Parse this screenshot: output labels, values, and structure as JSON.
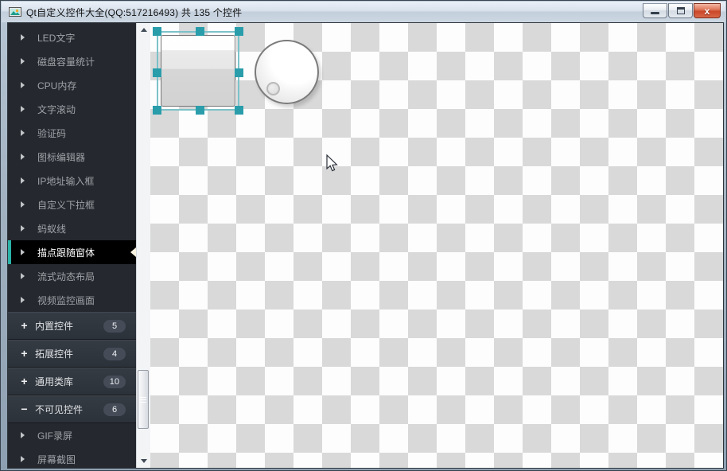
{
  "window": {
    "title": "Qt自定义控件大全(QQ:517216493) 共 135 个控件",
    "controls": {
      "minimize": "minimize-icon",
      "maximize": "maximize-icon",
      "close": "close-icon",
      "close_glyph": "x"
    }
  },
  "sidebar": {
    "items": [
      {
        "type": "item",
        "label": "LED文字"
      },
      {
        "type": "item",
        "label": "磁盘容量统计"
      },
      {
        "type": "item",
        "label": "CPU内存"
      },
      {
        "type": "item",
        "label": "文字滚动"
      },
      {
        "type": "item",
        "label": "验证码"
      },
      {
        "type": "item",
        "label": "图标编辑器"
      },
      {
        "type": "item",
        "label": "IP地址输入框"
      },
      {
        "type": "item",
        "label": "自定义下拉框"
      },
      {
        "type": "item",
        "label": "蚂蚁线"
      },
      {
        "type": "item",
        "label": "描点跟随窗体",
        "selected": true
      },
      {
        "type": "item",
        "label": "流式动态布局"
      },
      {
        "type": "item",
        "label": "视频监控画面"
      },
      {
        "type": "group",
        "label": "内置控件",
        "badge": "5",
        "state": "collapsed"
      },
      {
        "type": "group",
        "label": "拓展控件",
        "badge": "4",
        "state": "collapsed"
      },
      {
        "type": "group",
        "label": "通用类库",
        "badge": "10",
        "state": "collapsed"
      },
      {
        "type": "group",
        "label": "不可见控件",
        "badge": "6",
        "state": "expanded"
      },
      {
        "type": "item",
        "label": "GIF录屏"
      },
      {
        "type": "item",
        "label": "屏幕截图"
      }
    ]
  },
  "colors": {
    "accent_teal": "#2bb3a8",
    "selection_handle": "#2a9dab",
    "sidebar_bg": "#25282e",
    "selected_bg": "#000000",
    "checker_light": "#fdfdfd",
    "checker_dark": "#d9d9d9",
    "close_button_red": "#cb4729"
  }
}
